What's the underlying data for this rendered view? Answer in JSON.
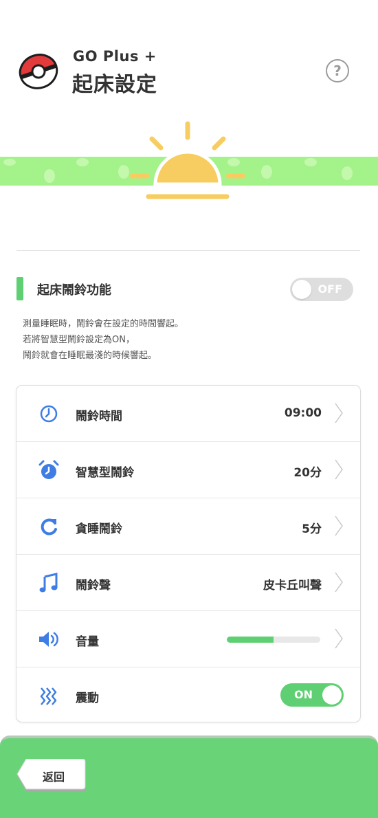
{
  "header": {
    "subtitle": "GO Plus +",
    "title": "起床設定",
    "help_icon": "question-circle-icon",
    "help_label": "?"
  },
  "feature": {
    "label": "起床鬧鈴功能",
    "toggle_state": "OFF",
    "description": [
      "測量睡眠時，鬧鈴會在設定的時間響起。",
      "若將智慧型鬧鈴設定為ON，",
      "鬧鈴就會在睡眠最淺的時候響起。"
    ]
  },
  "settings": {
    "items": [
      {
        "label": "鬧鈴時間",
        "value": "09:00",
        "icon": "clock-icon"
      },
      {
        "label": "智慧型鬧鈴",
        "value": "20分",
        "icon": "alarm-clock-icon"
      },
      {
        "label": "貪睡鬧鈴",
        "value": "5分",
        "icon": "refresh-icon"
      },
      {
        "label": "鬧鈴聲",
        "value": "皮卡丘叫聲",
        "icon": "music-note-icon"
      },
      {
        "label": "音量",
        "value": "",
        "icon": "speaker-icon",
        "level": 0.5
      },
      {
        "label": "震動",
        "value": "",
        "icon": "vibration-icon",
        "toggle_state": "ON"
      }
    ]
  },
  "footer": {
    "back_label": "返回"
  },
  "colors": {
    "accent_green": "#5ecf72",
    "icon_blue": "#3d7de4",
    "sun_yellow": "#f7cd62",
    "banner_green": "#a4f38a"
  }
}
